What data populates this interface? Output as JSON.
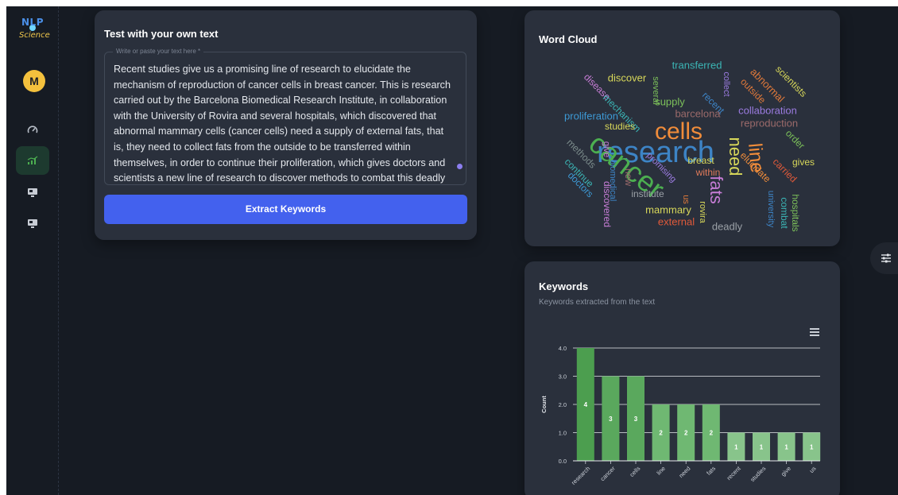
{
  "logo": {
    "line1": "NLP",
    "line2": "Science"
  },
  "user": {
    "initial": "M"
  },
  "sidebar": {
    "items": [
      {
        "icon": "dashboard-gauge-icon",
        "active": false
      },
      {
        "icon": "analytics-chart-icon",
        "active": true
      },
      {
        "icon": "monitor-icon",
        "active": false
      },
      {
        "icon": "monitor-icon",
        "active": false
      }
    ]
  },
  "test_panel": {
    "title": "Test with your own text",
    "field_label": "Write or paste your text here *",
    "text_lines": [
      "Recent studies give us a promising line of research to elucidate the",
      "mechanism of reproduction of cancer cells in breast cancer. This is research",
      "carried out by the Barcelona Biomedical Research Institute, in collaboration",
      "with the University of Rovira and several hospitals, which discovered that",
      "abnormal mammary cells (cancer cells) need a supply of external fats, that",
      "is, they need to collect fats from the outside to be transferred within",
      "themselves, in order to continue their proliferation, which gives doctors and",
      "scientists a new line of research to discover methods to combat this deadly"
    ],
    "button_label": "Extract Keywords"
  },
  "word_cloud": {
    "title": "Word Cloud",
    "words": [
      {
        "text": "research",
        "color": "#3d84c6",
        "size": 38
      },
      {
        "text": "cancer",
        "color": "#4caf50",
        "size": 36
      },
      {
        "text": "cells",
        "color": "#f08c3a",
        "size": 30
      },
      {
        "text": "line",
        "color": "#f08c3a",
        "size": 24
      },
      {
        "text": "need",
        "color": "#d8d85a",
        "size": 22
      },
      {
        "text": "fats",
        "color": "#c77dd6",
        "size": 22
      },
      {
        "text": "transferred",
        "color": "#3bb5b5",
        "size": 13
      },
      {
        "text": "discover",
        "color": "#d8d85a",
        "size": 13
      },
      {
        "text": "abnormal",
        "color": "#e0793a",
        "size": 13
      },
      {
        "text": "scientists",
        "color": "#d8d85a",
        "size": 12
      },
      {
        "text": "disease",
        "color": "#c77dd6",
        "size": 12
      },
      {
        "text": "several",
        "color": "#7cc05a",
        "size": 11
      },
      {
        "text": "collect",
        "color": "#9b7be0",
        "size": 11
      },
      {
        "text": "outside",
        "color": "#e0793a",
        "size": 12
      },
      {
        "text": "mechanism",
        "color": "#3bb5b5",
        "size": 12
      },
      {
        "text": "supply",
        "color": "#7cc05a",
        "size": 13
      },
      {
        "text": "recent",
        "color": "#3d84c6",
        "size": 12
      },
      {
        "text": "collaboration",
        "color": "#9b7be0",
        "size": 13
      },
      {
        "text": "proliferation",
        "color": "#3d9ad6",
        "size": 13
      },
      {
        "text": "barcelona",
        "color": "#9b6a6a",
        "size": 13
      },
      {
        "text": "reproduction",
        "color": "#9b6a6a",
        "size": 13
      },
      {
        "text": "studies",
        "color": "#d8d85a",
        "size": 12
      },
      {
        "text": "order",
        "color": "#7cc05a",
        "size": 12
      },
      {
        "text": "methods",
        "color": "#7a8a8a",
        "size": 12
      },
      {
        "text": "give",
        "color": "#c77dd6",
        "size": 11
      },
      {
        "text": "breast",
        "color": "#d8d85a",
        "size": 12
      },
      {
        "text": "elucidate",
        "color": "#f08c3a",
        "size": 12
      },
      {
        "text": "carried",
        "color": "#e05a3a",
        "size": 12
      },
      {
        "text": "gives",
        "color": "#d8d85a",
        "size": 12
      },
      {
        "text": "continue",
        "color": "#3bb5b5",
        "size": 12
      },
      {
        "text": "promising",
        "color": "#9b7be0",
        "size": 11
      },
      {
        "text": "new",
        "color": "#9b6a6a",
        "size": 12
      },
      {
        "text": "within",
        "color": "#e07a5a",
        "size": 12
      },
      {
        "text": "biomedical",
        "color": "#3d84c6",
        "size": 11
      },
      {
        "text": "doctors",
        "color": "#3d9ad6",
        "size": 12
      },
      {
        "text": "discovered",
        "color": "#c77dd6",
        "size": 12
      },
      {
        "text": "institute",
        "color": "#9aa0a6",
        "size": 12
      },
      {
        "text": "us",
        "color": "#e0793a",
        "size": 11
      },
      {
        "text": "university",
        "color": "#3d84c6",
        "size": 11
      },
      {
        "text": "combat",
        "color": "#3bb5b5",
        "size": 12
      },
      {
        "text": "hospitals",
        "color": "#7cc05a",
        "size": 12
      },
      {
        "text": "mammary",
        "color": "#d8d85a",
        "size": 13
      },
      {
        "text": "rovira",
        "color": "#d8d85a",
        "size": 11
      },
      {
        "text": "external",
        "color": "#e05a3a",
        "size": 13
      },
      {
        "text": "deadly",
        "color": "#9aa0a6",
        "size": 13
      }
    ]
  },
  "keywords_panel": {
    "title": "Keywords",
    "subtitle": "Keywords extracted from the text"
  },
  "chart_data": {
    "type": "bar",
    "categories": [
      "research",
      "cancer",
      "cells",
      "line",
      "need",
      "fats",
      "recent",
      "studies",
      "give",
      "us"
    ],
    "values": [
      4,
      3,
      3,
      2,
      2,
      2,
      1,
      1,
      1,
      1
    ],
    "ylabel": "Count",
    "ylim": [
      0,
      4
    ],
    "yticks": [
      "0.0",
      "1.0",
      "2.0",
      "3.0",
      "4.0"
    ],
    "colors": [
      "#4c9e4f",
      "#5aa85d",
      "#5aa85d",
      "#6fb872",
      "#6fb872",
      "#6fb872",
      "#88c48b",
      "#88c48b",
      "#88c48b",
      "#88c48b"
    ],
    "grid": true,
    "data_labels": true
  }
}
